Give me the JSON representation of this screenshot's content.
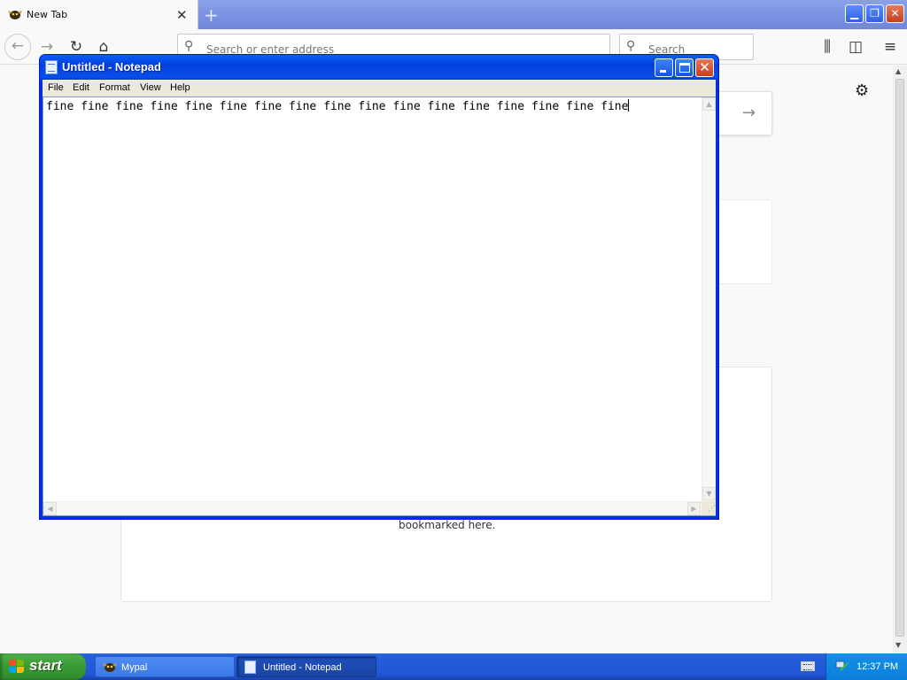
{
  "browser": {
    "tab_title": "New Tab",
    "tab_close": "✕",
    "new_tab_symbol": "+",
    "address_placeholder": "Search or enter address",
    "search_placeholder": "Search",
    "bookmarks_text": "bookmarked here."
  },
  "notepad": {
    "title": "Untitled - Notepad",
    "menu": [
      "File",
      "Edit",
      "Format",
      "View",
      "Help"
    ],
    "text": "fine fine fine fine fine fine fine fine fine fine fine fine fine fine fine fine fine"
  },
  "taskbar": {
    "start_label": "start",
    "tasks": [
      {
        "label": "Mypal",
        "active": false
      },
      {
        "label": "Untitled - Notepad",
        "active": true
      }
    ],
    "clock": "12:37 PM"
  },
  "colors": {
    "titlebar_blue": "#0a5ef5",
    "close_red": "#c6411e",
    "start_green": "#3a9a36",
    "taskbar_blue": "#245edb",
    "tab_strip": "#7b91e0"
  },
  "icons": [
    "mypal-icon",
    "back-icon",
    "forward-icon",
    "reload-icon",
    "home-icon",
    "search-icon",
    "library-icon",
    "sidebar-icon",
    "hamburger-menu-icon",
    "gear-icon",
    "arrow-right-icon",
    "notepad-icon",
    "windows-flag-icon",
    "keyboard-icon",
    "network-icon"
  ]
}
